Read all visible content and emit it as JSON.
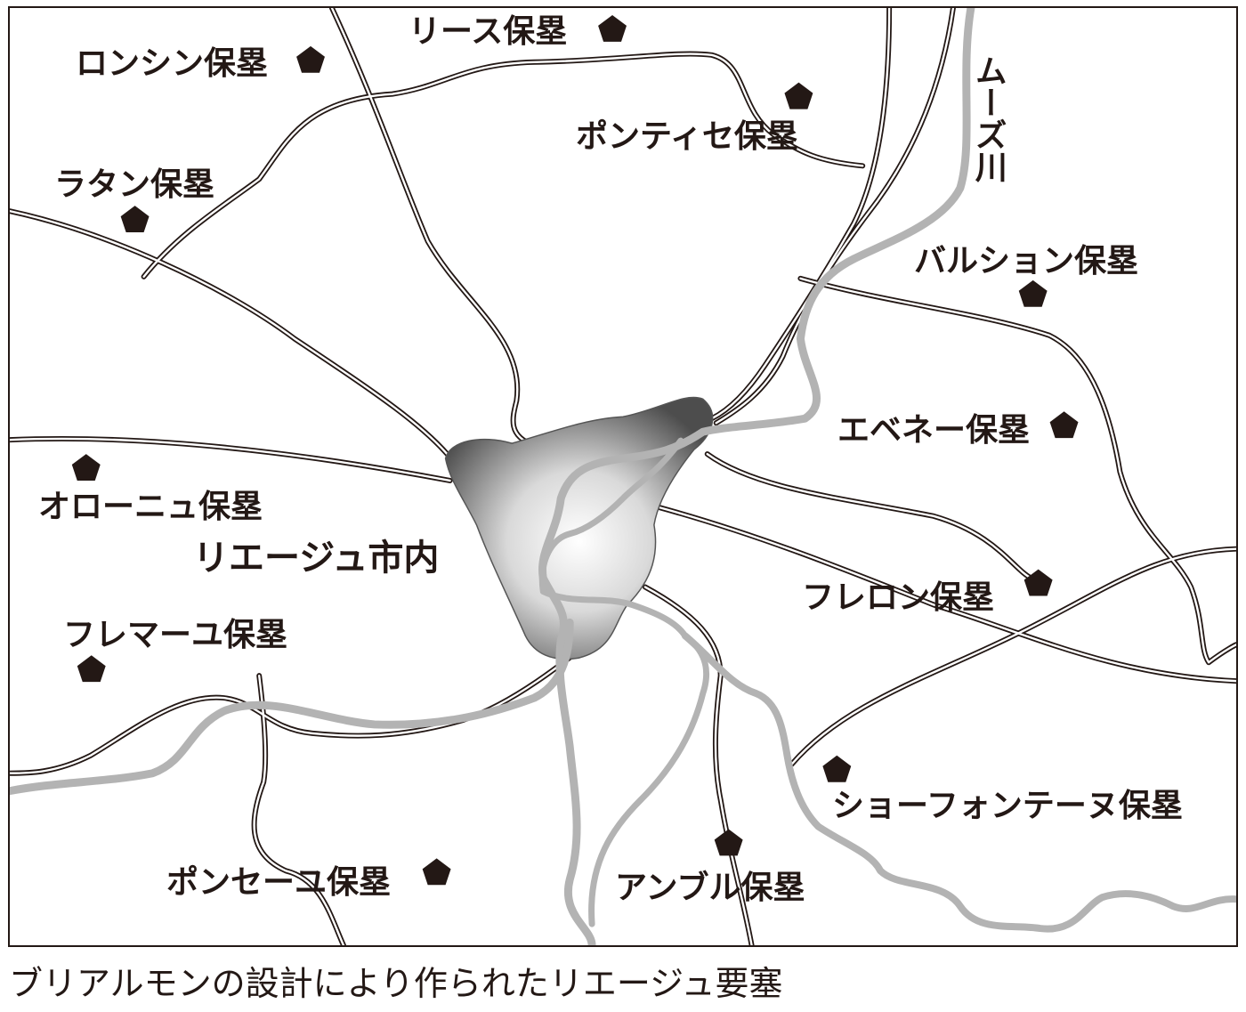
{
  "colors": {
    "ink": "#231815",
    "river": "#b3b3b3",
    "road": "#231815",
    "city_dark": "#4d4d4d",
    "city_light": "#ffffff"
  },
  "river": {
    "name": "ムーズ川"
  },
  "city": {
    "name": "リエージュ市内"
  },
  "forts": [
    {
      "name": "ロンシン保塁",
      "icon": "pentagon-marker-icon"
    },
    {
      "name": "リース保塁",
      "icon": "pentagon-marker-icon"
    },
    {
      "name": "ポンティセ保塁",
      "icon": "pentagon-marker-icon"
    },
    {
      "name": "ラタン保塁",
      "icon": "pentagon-marker-icon"
    },
    {
      "name": "バルション保塁",
      "icon": "pentagon-marker-icon"
    },
    {
      "name": "エベネー保塁",
      "icon": "pentagon-marker-icon"
    },
    {
      "name": "オローニュ保塁",
      "icon": "pentagon-marker-icon"
    },
    {
      "name": "フレロン保塁",
      "icon": "pentagon-marker-icon"
    },
    {
      "name": "フレマーユ保塁",
      "icon": "pentagon-marker-icon"
    },
    {
      "name": "ショーフォンテーヌ保塁",
      "icon": "pentagon-marker-icon"
    },
    {
      "name": "ポンセーユ保塁",
      "icon": "pentagon-marker-icon"
    },
    {
      "name": "アンブル保塁",
      "icon": "pentagon-marker-icon"
    }
  ],
  "caption": "ブリアルモンの設計により作られたリエージュ要塞"
}
